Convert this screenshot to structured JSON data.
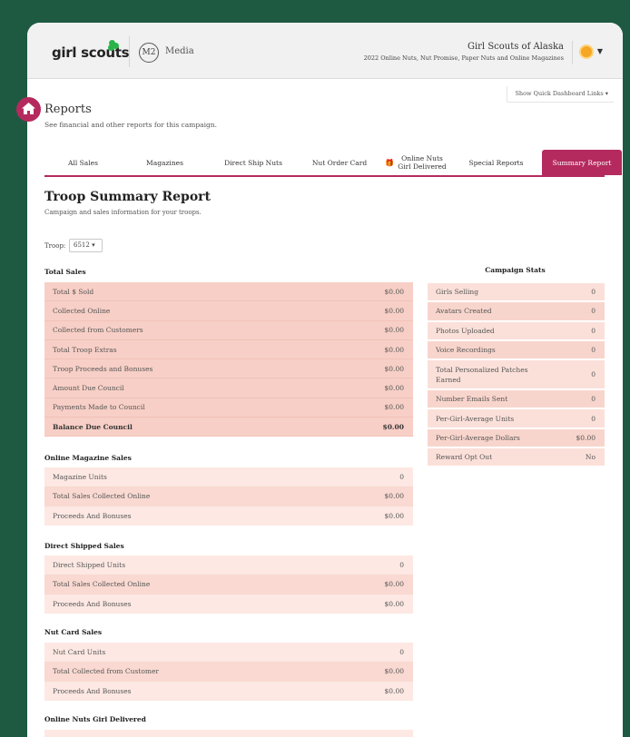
{
  "header": {
    "logo_text": "girl scouts",
    "brand_badge": "M2",
    "brand_name": "Media",
    "council": "Girl Scouts of Alaska",
    "campaign": "2022 Online Nuts, Nut Promise, Paper Nuts and Online Magazines",
    "quick_links": "Show Quick Dashboard Links"
  },
  "page": {
    "title": "Reports",
    "subtitle": "See financial and other reports for this campaign."
  },
  "tabs": [
    "All Sales",
    "Magazines",
    "Direct Ship Nuts",
    "Nut Order Card",
    "Online Nuts Girl Delivered",
    "Special Reports",
    "Summary Report"
  ],
  "report": {
    "title": "Troop Summary Report",
    "subtitle": "Campaign and sales information for your troops.",
    "troop_label": "Troop:",
    "troop_value": "6512"
  },
  "total_sales": {
    "title": "Total Sales",
    "rows": [
      {
        "label": "Total $ Sold",
        "value": "$0.00"
      },
      {
        "label": "Collected Online",
        "value": "$0.00"
      },
      {
        "label": "Collected from Customers",
        "value": "$0.00"
      },
      {
        "label": "Total Troop Extras",
        "value": "$0.00"
      },
      {
        "label": "Troop Proceeds and Bonuses",
        "value": "$0.00"
      },
      {
        "label": "Amount Due Council",
        "value": "$0.00"
      },
      {
        "label": "Payments Made to Council",
        "value": "$0.00"
      },
      {
        "label": "Balance Due Council",
        "value": "$0.00"
      }
    ]
  },
  "online_magazine": {
    "title": "Online Magazine Sales",
    "rows": [
      {
        "label": "Magazine Units",
        "value": "0"
      },
      {
        "label": "Total Sales Collected Online",
        "value": "$0.00"
      },
      {
        "label": "Proceeds And Bonuses",
        "value": "$0.00"
      }
    ]
  },
  "direct_shipped": {
    "title": "Direct Shipped Sales",
    "rows": [
      {
        "label": "Direct Shipped Units",
        "value": "0"
      },
      {
        "label": "Total Sales Collected Online",
        "value": "$0.00"
      },
      {
        "label": "Proceeds And Bonuses",
        "value": "$0.00"
      }
    ]
  },
  "nut_card": {
    "title": "Nut Card Sales",
    "rows": [
      {
        "label": "Nut Card Units",
        "value": "0"
      },
      {
        "label": "Total Collected from Customer",
        "value": "$0.00"
      },
      {
        "label": "Proceeds And Bonuses",
        "value": "$0.00"
      }
    ]
  },
  "online_nuts": {
    "title": "Online Nuts Girl Delivered"
  },
  "campaign_stats": {
    "title": "Campaign Stats",
    "rows": [
      {
        "label": "Girls Selling",
        "value": "0"
      },
      {
        "label": "Avatars Created",
        "value": "0"
      },
      {
        "label": "Photos Uploaded",
        "value": "0"
      },
      {
        "label": "Voice Recordings",
        "value": "0"
      },
      {
        "label": "Total Personalized Patches Earned",
        "value": "0"
      },
      {
        "label": "Number Emails Sent",
        "value": "0"
      },
      {
        "label": "Per-Girl-Average Units",
        "value": "0"
      },
      {
        "label": "Per-Girl-Average Dollars",
        "value": "$0.00"
      },
      {
        "label": "Reward Opt Out",
        "value": "No"
      }
    ]
  },
  "colors": {
    "accent": "#b52a5e",
    "background": "#1e5a42",
    "row_pink": "#f7cfc6"
  }
}
